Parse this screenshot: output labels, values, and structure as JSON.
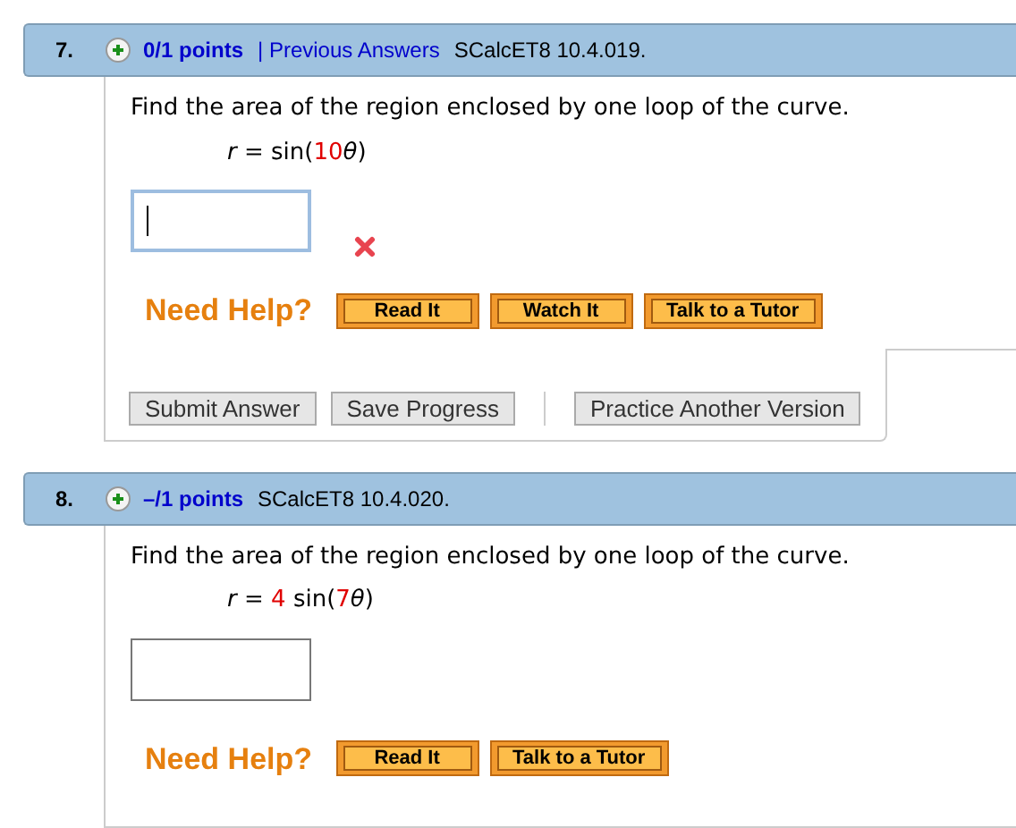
{
  "questions": [
    {
      "number": "7.",
      "points": "0/1 points",
      "previous_answers": "| Previous Answers",
      "source": "SCalcET8 10.4.019.",
      "prompt": "Find the area of the region enclosed by one loop of the curve.",
      "formula": [
        {
          "text": "r",
          "kind": "italic"
        },
        {
          "text": " = sin(",
          "kind": "plain"
        },
        {
          "text": "10",
          "kind": "given"
        },
        {
          "text": "θ",
          "kind": "italic"
        },
        {
          "text": ")",
          "kind": "plain"
        }
      ],
      "answer": {
        "focused": true,
        "incorrect": true
      },
      "need_help": "Need Help?",
      "help_buttons": [
        "Read It",
        "Watch It",
        "Talk to a Tutor"
      ],
      "actions": [
        {
          "label": "Submit Answer",
          "kind": "button"
        },
        {
          "label": "Save Progress",
          "kind": "button"
        },
        {
          "kind": "separator"
        },
        {
          "label": "Practice Another Version",
          "kind": "button"
        }
      ]
    },
    {
      "number": "8.",
      "points": "–/1 points",
      "source": "SCalcET8 10.4.020.",
      "prompt": "Find the area of the region enclosed by one loop of the curve.",
      "formula": [
        {
          "text": "r",
          "kind": "italic"
        },
        {
          "text": " = ",
          "kind": "plain"
        },
        {
          "text": "4",
          "kind": "given"
        },
        {
          "text": " sin(",
          "kind": "plain"
        },
        {
          "text": "7",
          "kind": "given"
        },
        {
          "text": "θ",
          "kind": "italic"
        },
        {
          "text": ")",
          "kind": "plain"
        }
      ],
      "answer": {
        "focused": false,
        "incorrect": false
      },
      "need_help": "Need Help?",
      "help_buttons": [
        "Read It",
        "Talk to a Tutor"
      ]
    }
  ]
}
